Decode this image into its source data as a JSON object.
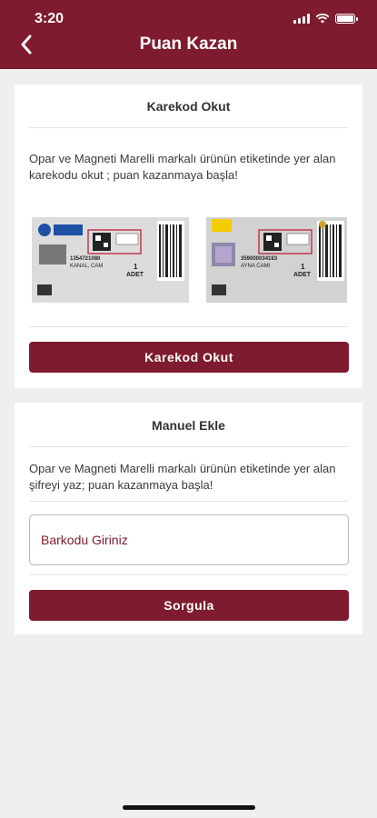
{
  "status_bar": {
    "time": "3:20"
  },
  "header": {
    "title": "Puan Kazan",
    "back_icon": "chevron-left-icon"
  },
  "qr_card": {
    "title": "Karekod Okut",
    "description": "Opar ve Magneti Marelli markalı ürünün etiketinde yer alan karekodu okut ; puan kazanmaya başla!",
    "button_label": "Karekod Okut",
    "sample_labels": [
      {
        "brand": "Opar",
        "code": "1354721080",
        "name": "KANAL, CAM",
        "qty": "1",
        "unit": "ADET"
      },
      {
        "brand": "Magneti Marelli",
        "code": "359000034183",
        "name": "AYNA CAMI",
        "qty": "1",
        "unit": "ADET"
      }
    ]
  },
  "manual_card": {
    "title": "Manuel Ekle",
    "description": "Opar ve Magneti Marelli markalı ürünün etiketinde yer alan şifreyi yaz; puan kazanmaya başla!",
    "input_placeholder": "Barkodu Giriniz",
    "input_value": "",
    "button_label": "Sorgula"
  },
  "colors": {
    "brand": "#7e1b2e",
    "background": "#efefef"
  }
}
